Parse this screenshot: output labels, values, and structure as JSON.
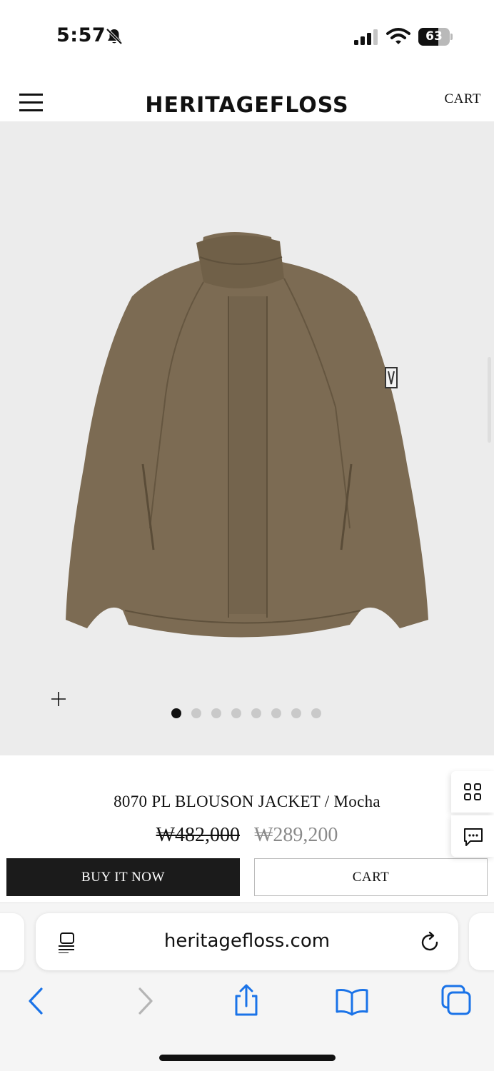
{
  "status_bar": {
    "time": "5:57",
    "battery": "63",
    "battery_level": 0.63
  },
  "header": {
    "brand": "HERITAGEFLOSS",
    "cart_label": "CART",
    "menu_icon": "hamburger-menu-icon"
  },
  "gallery": {
    "zoom_icon": "plus",
    "slide_count": 8,
    "active_slide": 1,
    "colors": {
      "background": "#ececec",
      "jacket": "#7c6b53"
    }
  },
  "product": {
    "name": "8070 PL BLOUSON JACKET / Mocha",
    "price_original": "₩482,000",
    "price_sale": "₩289,200",
    "buy_now_label": "BUY IT NOW",
    "cart_label": "CART"
  },
  "floating": {
    "grid_icon": "grid-icon",
    "chat_icon": "chat-icon"
  },
  "browser": {
    "url": "heritagefloss.com",
    "toolbar_icons": [
      "back-icon",
      "forward-icon",
      "share-icon",
      "bookmarks-icon",
      "tabs-icon"
    ],
    "accent": "#1a73e8"
  }
}
